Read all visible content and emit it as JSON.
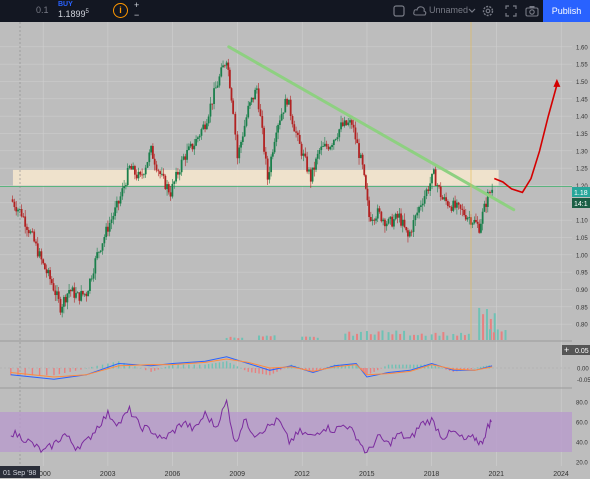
{
  "toolbar": {
    "quantity": "0.1",
    "buy_label": "BUY",
    "buy_price": "1.1899",
    "buy_price_sup": "5",
    "info_glyph": "i",
    "plus": "+",
    "minus": "−",
    "layout_name": "Unnamed",
    "publish_label": "Publish",
    "icons": [
      "rectangle-icon",
      "cloud-icon",
      "chevron-down-icon",
      "gear-icon",
      "fullscreen-icon",
      "camera-icon"
    ]
  },
  "price_badge": {
    "price": "1.18",
    "countdown": "14:1"
  },
  "indicator_badge": {
    "value": "0.05",
    "plus": "+"
  },
  "date_badge": "01 Sep '98",
  "colors": {
    "background": "#bdbdbd",
    "toolbar": "#131722",
    "up_candle": "#1a7f4b",
    "down_candle": "#b22222",
    "trendline": "#8ed081",
    "zone": "#f1e4cc",
    "arrow": "#d40000",
    "rsi_band": "#b89bcc",
    "rsi_line": "#7b2c9e",
    "macd_line": "#2962ff",
    "signal_line": "#ff8a3d",
    "badge_green": "#26a69a",
    "publish": "#2962ff"
  },
  "chart_data": [
    {
      "type": "candlestick",
      "x_ticks": [
        "2000",
        "2003",
        "2006",
        "2009",
        "2012",
        "2015",
        "2018",
        "2021",
        "2024"
      ],
      "y_ticks": [
        "1.60",
        "1.55",
        "1.50",
        "1.45",
        "1.40",
        "1.35",
        "1.30",
        "1.25",
        "1.20",
        "1.15",
        "1.10",
        "1.05",
        "1.00",
        "0.95",
        "0.90",
        "0.85",
        "0.80"
      ],
      "ylim": [
        0.76,
        1.66
      ],
      "xlim": [
        1998.0,
        2024.5
      ],
      "closes": [
        [
          1998.5,
          1.16
        ],
        [
          1999.0,
          1.12
        ],
        [
          1999.5,
          1.05
        ],
        [
          2000.0,
          0.97
        ],
        [
          2000.4,
          0.92
        ],
        [
          2000.8,
          0.85
        ],
        [
          2001.2,
          0.9
        ],
        [
          2001.6,
          0.88
        ],
        [
          2002.0,
          0.89
        ],
        [
          2002.5,
          1.0
        ],
        [
          2003.0,
          1.08
        ],
        [
          2003.5,
          1.15
        ],
        [
          2004.0,
          1.25
        ],
        [
          2004.5,
          1.22
        ],
        [
          2005.0,
          1.3
        ],
        [
          2005.5,
          1.22
        ],
        [
          2005.9,
          1.18
        ],
        [
          2006.5,
          1.28
        ],
        [
          2007.0,
          1.32
        ],
        [
          2007.5,
          1.38
        ],
        [
          2008.0,
          1.48
        ],
        [
          2008.5,
          1.57
        ],
        [
          2008.8,
          1.42
        ],
        [
          2009.0,
          1.28
        ],
        [
          2009.5,
          1.42
        ],
        [
          2009.9,
          1.48
        ],
        [
          2010.4,
          1.22
        ],
        [
          2010.8,
          1.37
        ],
        [
          2011.3,
          1.45
        ],
        [
          2011.8,
          1.33
        ],
        [
          2012.4,
          1.22
        ],
        [
          2012.8,
          1.3
        ],
        [
          2013.3,
          1.32
        ],
        [
          2013.8,
          1.37
        ],
        [
          2014.3,
          1.38
        ],
        [
          2014.8,
          1.25
        ],
        [
          2015.1,
          1.11
        ],
        [
          2015.5,
          1.12
        ],
        [
          2016.0,
          1.09
        ],
        [
          2016.5,
          1.11
        ],
        [
          2016.9,
          1.05
        ],
        [
          2017.5,
          1.15
        ],
        [
          2018.1,
          1.23
        ],
        [
          2018.5,
          1.16
        ],
        [
          2019.0,
          1.14
        ],
        [
          2019.5,
          1.12
        ],
        [
          2019.9,
          1.1
        ],
        [
          2020.2,
          1.08
        ],
        [
          2020.6,
          1.17
        ],
        [
          2020.8,
          1.19
        ]
      ],
      "volumes": [
        [
          2008.5,
          0.3
        ],
        [
          2010.0,
          0.4
        ],
        [
          2012.0,
          0.3
        ],
        [
          2014.0,
          0.7
        ],
        [
          2015.0,
          0.9
        ],
        [
          2016.0,
          0.8
        ],
        [
          2017.0,
          0.7
        ],
        [
          2018.0,
          0.7
        ],
        [
          2019.0,
          0.6
        ],
        [
          2020.2,
          2.8
        ],
        [
          2020.7,
          0.9
        ]
      ],
      "annotations": {
        "trendline": [
          [
            2008.6,
            1.6
          ],
          [
            2021.8,
            1.13
          ]
        ],
        "zone": [
          1.2,
          1.245
        ],
        "projection": [
          [
            2020.9,
            1.22
          ],
          [
            2021.3,
            1.21
          ],
          [
            2021.7,
            1.19
          ],
          [
            2022.2,
            1.18
          ],
          [
            2022.6,
            1.22
          ],
          [
            2023.0,
            1.3
          ],
          [
            2023.4,
            1.4
          ],
          [
            2023.8,
            1.49
          ]
        ]
      }
    },
    {
      "type": "line",
      "title": "",
      "y_ticks": [
        "0.05",
        "0.00",
        "-0.05"
      ],
      "ylim": [
        -0.08,
        0.08
      ],
      "series": [
        {
          "values": [
            [
              1998.5,
              -0.03
            ],
            [
              2000.5,
              -0.05
            ],
            [
              2002.0,
              -0.03
            ],
            [
              2003.5,
              0.02
            ],
            [
              2005.0,
              0.01
            ],
            [
              2006.0,
              0.02
            ],
            [
              2007.5,
              0.03
            ],
            [
              2008.5,
              0.05
            ],
            [
              2009.5,
              0.02
            ],
            [
              2010.5,
              -0.01
            ],
            [
              2011.5,
              0.01
            ],
            [
              2012.5,
              -0.02
            ],
            [
              2013.5,
              0.01
            ],
            [
              2014.5,
              0.02
            ],
            [
              2015.0,
              -0.04
            ],
            [
              2016.0,
              -0.02
            ],
            [
              2017.0,
              -0.01
            ],
            [
              2018.0,
              0.02
            ],
            [
              2019.0,
              -0.01
            ],
            [
              2020.0,
              -0.01
            ],
            [
              2020.8,
              0.01
            ]
          ]
        },
        {
          "values": [
            [
              1998.5,
              -0.02
            ],
            [
              2000.5,
              -0.04
            ],
            [
              2002.0,
              -0.03
            ],
            [
              2003.5,
              0.01
            ],
            [
              2005.0,
              0.015
            ],
            [
              2006.0,
              0.015
            ],
            [
              2007.5,
              0.025
            ],
            [
              2008.5,
              0.04
            ],
            [
              2009.5,
              0.025
            ],
            [
              2010.5,
              0.0
            ],
            [
              2011.5,
              0.005
            ],
            [
              2012.5,
              -0.015
            ],
            [
              2013.5,
              0.005
            ],
            [
              2014.5,
              0.015
            ],
            [
              2015.0,
              -0.03
            ],
            [
              2016.0,
              -0.025
            ],
            [
              2017.0,
              -0.015
            ],
            [
              2018.0,
              0.015
            ],
            [
              2019.0,
              -0.005
            ],
            [
              2020.0,
              -0.01
            ],
            [
              2020.8,
              0.005
            ]
          ]
        }
      ]
    },
    {
      "type": "line",
      "y_ticks": [
        "80.0",
        "60.0",
        "40.0",
        "20.0"
      ],
      "ylim": [
        18,
        90
      ],
      "band": [
        30,
        70
      ],
      "series": [
        {
          "values": [
            [
              1998.5,
              50
            ],
            [
              1999.0,
              45
            ],
            [
              1999.5,
              38
            ],
            [
              2000.0,
              30
            ],
            [
              2000.5,
              38
            ],
            [
              2001.0,
              48
            ],
            [
              2001.5,
              35
            ],
            [
              2002.0,
              40
            ],
            [
              2002.5,
              55
            ],
            [
              2003.0,
              68
            ],
            [
              2003.5,
              58
            ],
            [
              2004.0,
              72
            ],
            [
              2004.5,
              55
            ],
            [
              2005.0,
              52
            ],
            [
              2005.5,
              42
            ],
            [
              2006.0,
              50
            ],
            [
              2006.5,
              60
            ],
            [
              2007.0,
              52
            ],
            [
              2007.5,
              68
            ],
            [
              2008.0,
              55
            ],
            [
              2008.5,
              80
            ],
            [
              2008.9,
              38
            ],
            [
              2009.3,
              62
            ],
            [
              2009.8,
              48
            ],
            [
              2010.4,
              55
            ],
            [
              2010.9,
              62
            ],
            [
              2011.4,
              40
            ],
            [
              2011.9,
              50
            ],
            [
              2012.5,
              45
            ],
            [
              2013.0,
              55
            ],
            [
              2013.5,
              52
            ],
            [
              2014.0,
              58
            ],
            [
              2014.5,
              46
            ],
            [
              2015.0,
              28
            ],
            [
              2015.5,
              45
            ],
            [
              2016.0,
              38
            ],
            [
              2016.5,
              48
            ],
            [
              2017.0,
              42
            ],
            [
              2017.5,
              58
            ],
            [
              2018.0,
              62
            ],
            [
              2018.5,
              45
            ],
            [
              2019.0,
              50
            ],
            [
              2019.5,
              42
            ],
            [
              2020.0,
              44
            ],
            [
              2020.3,
              38
            ],
            [
              2020.6,
              55
            ],
            [
              2020.8,
              63
            ]
          ]
        }
      ]
    }
  ]
}
